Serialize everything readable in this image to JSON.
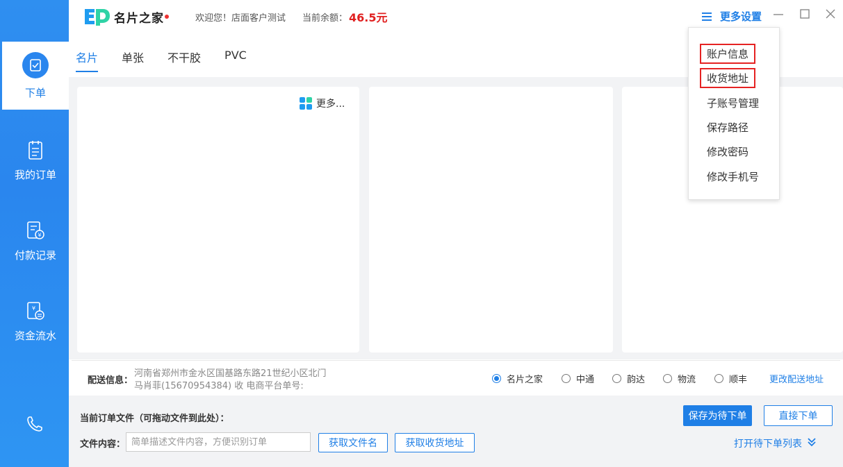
{
  "sidebar": {
    "items": [
      {
        "label": "下单",
        "icon": "order-icon",
        "active": true
      },
      {
        "label": "我的订单",
        "icon": "clipboard-icon"
      },
      {
        "label": "付款记录",
        "icon": "payment-record-icon"
      },
      {
        "label": "资金流水",
        "icon": "cash-flow-icon"
      }
    ],
    "phone_icon": "phone-icon",
    "color": "#2a86ee"
  },
  "header": {
    "logo_text": "名片之家",
    "welcome": "欢迎您！店面客户测试",
    "balance_label": "当前余额：",
    "balance_value": "46.5元",
    "more_settings": "更多设置"
  },
  "tabs": [
    "名片",
    "单张",
    "不干胶",
    "PVC"
  ],
  "panel": {
    "more_label": "更多..."
  },
  "shipping": {
    "title": "配送信息：",
    "address": "河南省郑州市金水区国基路东路21世纪小区北门",
    "receiver": "马肖菲(15670954384) 收   电商平台单号:",
    "carriers": [
      {
        "label": "名片之家",
        "selected": true
      },
      {
        "label": "中通"
      },
      {
        "label": "韵达"
      },
      {
        "label": "物流"
      },
      {
        "label": "顺丰"
      }
    ],
    "change_address": "更改配送地址"
  },
  "file": {
    "title": "当前订单文件（可拖动文件到此处）：",
    "content_label": "文件内容：",
    "content_placeholder": "简单描述文件内容，方便识别订单",
    "get_filename": "获取文件名",
    "get_address": "获取收货地址",
    "save_pending": "保存为待下单",
    "direct_order": "直接下单",
    "open_pending_list": "打开待下单列表"
  },
  "dropdown": {
    "items": [
      "账户信息",
      "收货地址",
      "子账号管理",
      "保存路径",
      "修改密码",
      "修改手机号"
    ]
  },
  "colors": {
    "accent": "#1f7fe6",
    "balance": "#e02020",
    "highlight_box": "#e52222"
  }
}
